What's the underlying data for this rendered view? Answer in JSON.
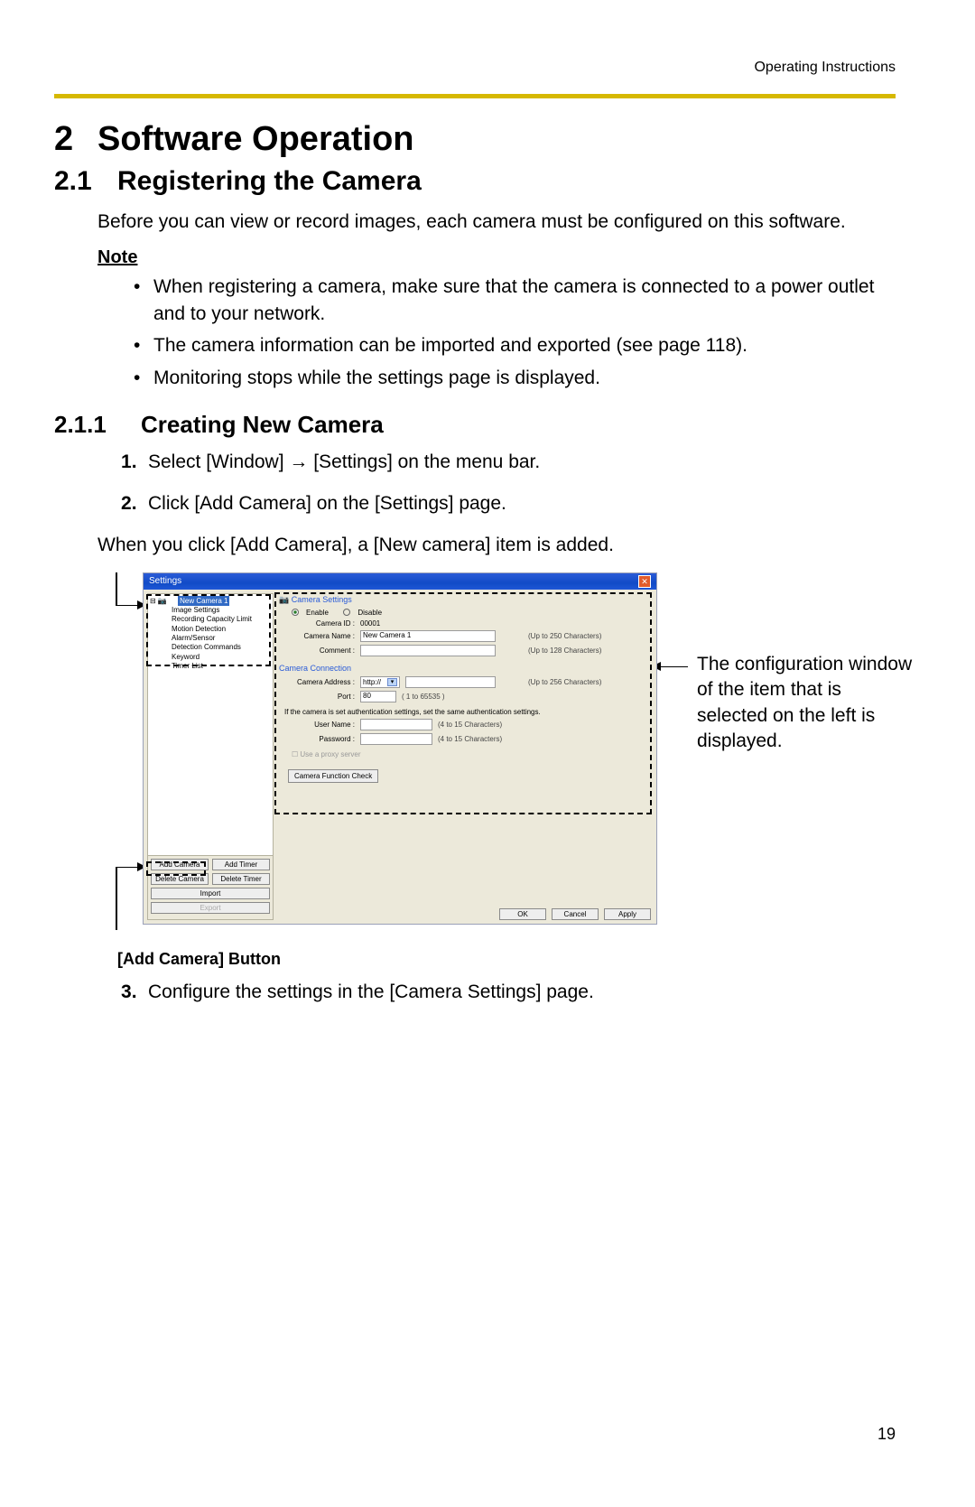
{
  "header": {
    "right": "Operating Instructions"
  },
  "h1": {
    "num": "2",
    "title": "Software Operation"
  },
  "h2": {
    "num": "2.1",
    "title": "Registering the Camera"
  },
  "intro": "Before you can view or record images, each camera must be configured on this software.",
  "note_head": "Note",
  "notes": [
    "When registering a camera, make sure that the camera is connected to a power outlet and to your network.",
    "The camera information can be imported and exported (see page 118).",
    "Monitoring stops while the settings page is displayed."
  ],
  "h3": {
    "num": "2.1.1",
    "title": "Creating New Camera"
  },
  "steps": [
    "Select [Window] → [Settings] on the menu bar.",
    "Click [Add Camera] on the [Settings] page."
  ],
  "add_line": "When you click [Add Camera], a [New camera] item is added.",
  "callout": "The configuration window of the item that is selected on the left is displayed.",
  "add_camera_caption": "[Add Camera] Button",
  "step3": "Configure the settings in the [Camera Settings] page.",
  "page_number": "19",
  "settings": {
    "title": "Settings",
    "tree": {
      "root": "New Camera 1",
      "children": [
        "Image Settings",
        "Recording Capacity Limit",
        "Motion Detection",
        "Alarm/Sensor",
        "Detection Commands",
        "Keyword",
        "Timer List"
      ]
    },
    "buttons": {
      "add_camera": "Add Camera",
      "add_timer": "Add Timer",
      "delete_camera": "Delete Camera",
      "delete_timer": "Delete Timer",
      "import": "Import",
      "export": "Export"
    },
    "form": {
      "section1_title": "Camera Settings",
      "enable": "Enable",
      "disable": "Disable",
      "camera_id_lbl": "Camera ID :",
      "camera_id_val": "00001",
      "camera_name_lbl": "Camera Name :",
      "camera_name_val": "New Camera 1",
      "camera_name_hint": "(Up to 250 Characters)",
      "comment_lbl": "Comment :",
      "comment_hint": "(Up to 128 Characters)",
      "section2_title": "Camera Connection",
      "addr_lbl": "Camera Address :",
      "proto": "http://",
      "addr_hint": "(Up to 256 Characters)",
      "port_lbl": "Port :",
      "port_val": "80",
      "port_hint": "( 1 to 65535 )",
      "auth_note": "If the camera is set authentication settings, set the same authentication settings.",
      "user_lbl": "User Name :",
      "user_hint": "(4 to 15 Characters)",
      "pass_lbl": "Password :",
      "pass_hint": "(4 to 15 Characters)",
      "proxy_chk": "Use a proxy server",
      "func_check": "Camera Function Check"
    },
    "bottom": {
      "ok": "OK",
      "cancel": "Cancel",
      "apply": "Apply"
    }
  }
}
